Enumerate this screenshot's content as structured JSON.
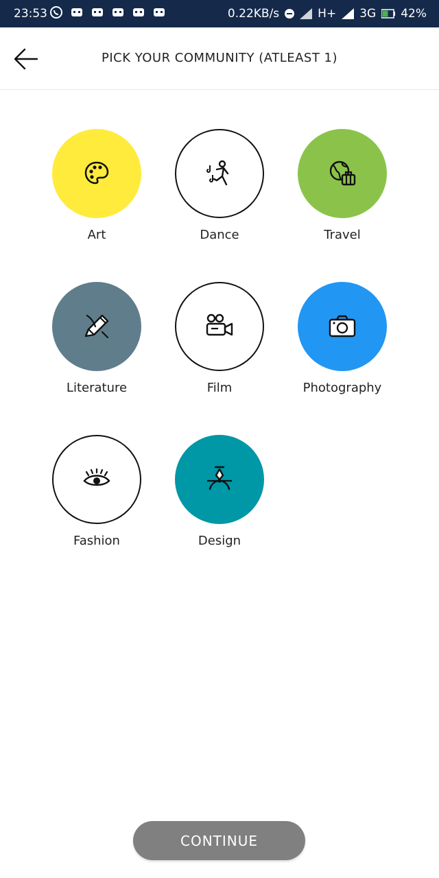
{
  "status_bar": {
    "time": "23:53",
    "speed": "0.22KB/s",
    "network": "H+",
    "carrier": "3G",
    "battery": "42%"
  },
  "header": {
    "title": "PICK YOUR COMMUNITY (ATLEAST 1)",
    "back_icon": "arrow-left-icon"
  },
  "communities": [
    {
      "label": "Art",
      "icon": "palette-icon",
      "color": "#FFEB3B",
      "selected": true
    },
    {
      "label": "Dance",
      "icon": "dancer-icon",
      "color": "#FFFFFF",
      "selected": false
    },
    {
      "label": "Travel",
      "icon": "globe-suitcase-icon",
      "color": "#8BC34A",
      "selected": true
    },
    {
      "label": "Literature",
      "icon": "pen-feather-icon",
      "color": "#607D8B",
      "selected": true
    },
    {
      "label": "Film",
      "icon": "video-camera-icon",
      "color": "#FFFFFF",
      "selected": false
    },
    {
      "label": "Photography",
      "icon": "camera-icon",
      "color": "#2196F3",
      "selected": true
    },
    {
      "label": "Fashion",
      "icon": "eye-lashes-icon",
      "color": "#FFFFFF",
      "selected": false
    },
    {
      "label": "Design",
      "icon": "pen-tool-icon",
      "color": "#0097A7",
      "selected": true
    }
  ],
  "continue_label": "CONTINUE",
  "colors": {
    "status_bar": "#152A4A",
    "continue_button": "#808080"
  }
}
